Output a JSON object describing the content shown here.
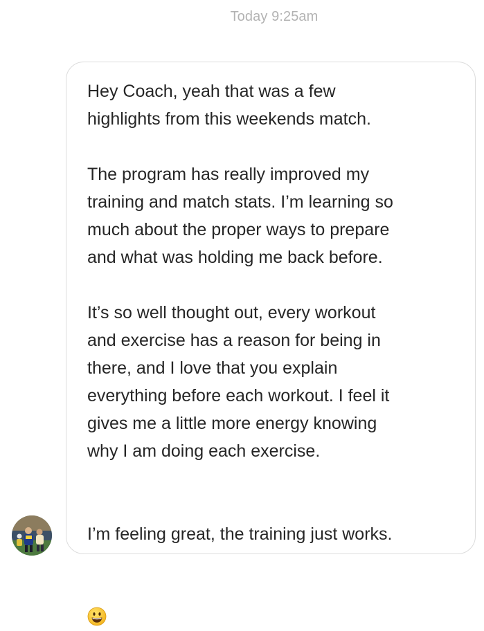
{
  "conversation": {
    "timestamp": "Today 9:25am",
    "message": {
      "paragraphs": [
        "Hey Coach, yeah that was a few\nhighlights from this weekends match.",
        "The program has really improved my\ntraining and match stats. I’m learning so\nmuch about the proper ways to prepare\nand what was holding me back before.",
        "It’s so well thought out, every workout\nand exercise has a reason for being in\nthere, and I love that you explain\neverything before each workout. I feel it\ngives me a little more energy knowing\nwhy I am doing each exercise.",
        "I’m feeling great, the training just works."
      ],
      "trailing_emoji": "grinning-face-emoji"
    },
    "sender": {
      "avatar_icon": "soccer-player-photo"
    }
  }
}
